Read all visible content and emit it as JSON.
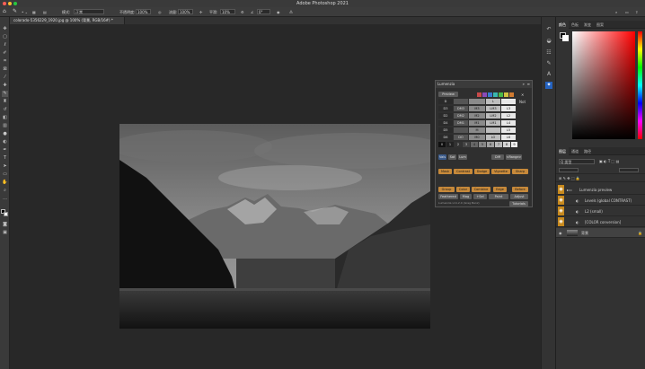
{
  "window": {
    "title": "Adobe Photoshop 2021"
  },
  "options_bar": {
    "mode_label": "模式:",
    "mode_value": "正常",
    "opacity_label": "不透明度:",
    "opacity_value": "100%",
    "flow_label": "流量:",
    "flow_value": "100%",
    "smooth_label": "平滑:",
    "smooth_value": "10%",
    "angle_value": "0°"
  },
  "document": {
    "tab_title": "colorado-5356229_1920.jpg @ 100% (背景, RGB/16#) *"
  },
  "color_panel": {
    "tabs": [
      "颜色",
      "色板",
      "渐变",
      "图案"
    ]
  },
  "layers_panel": {
    "tabs": [
      "图层",
      "通道",
      "路径"
    ],
    "kind_label": "Q 类型",
    "layers": [
      {
        "name": "Lumenzia preview"
      },
      {
        "name": "Levels (global CONTRAST)"
      },
      {
        "name": "L2 (small)"
      },
      {
        "name": "[COLOR conversion]"
      },
      {
        "name": "背景"
      }
    ]
  },
  "lumenzia": {
    "title": "Lumenzia",
    "preview_label": "Preview",
    "not_label": "Not",
    "zone_rows": [
      [
        "D",
        "",
        "",
        "L",
        ""
      ],
      [
        "D3",
        "DM3",
        "M3",
        "LM3",
        "L3"
      ],
      [
        "D2",
        "DM2",
        "M2",
        "LM2",
        "L2"
      ],
      [
        "D4",
        "DM1",
        "M1",
        "LM1",
        "L4"
      ],
      [
        "D5",
        "",
        "M",
        "",
        "L5"
      ],
      [
        "D6",
        "DO",
        "M0",
        "LO",
        "L6"
      ]
    ],
    "number_row": [
      "0",
      "1",
      "2",
      "3",
      "4",
      "5",
      "6",
      "7",
      "8",
      "9"
    ],
    "mode_buttons": [
      "Vals",
      "Sat",
      "Lum"
    ],
    "diff_label": "Diff",
    "range_label": "<Range>",
    "row1": [
      "Mask",
      "Contrast",
      "Dodge",
      "Vignette",
      "Sharp"
    ],
    "row2": [
      "Group",
      "Color",
      "Combine",
      "Edge",
      "Before"
    ],
    "row3": [
      "Feathered",
      "Mag",
      "+Sel",
      "Paint",
      "Adjust"
    ],
    "version": "Lumenzia v11.2.0 (Greg Benz)",
    "tutorials_label": "Tutorials"
  }
}
